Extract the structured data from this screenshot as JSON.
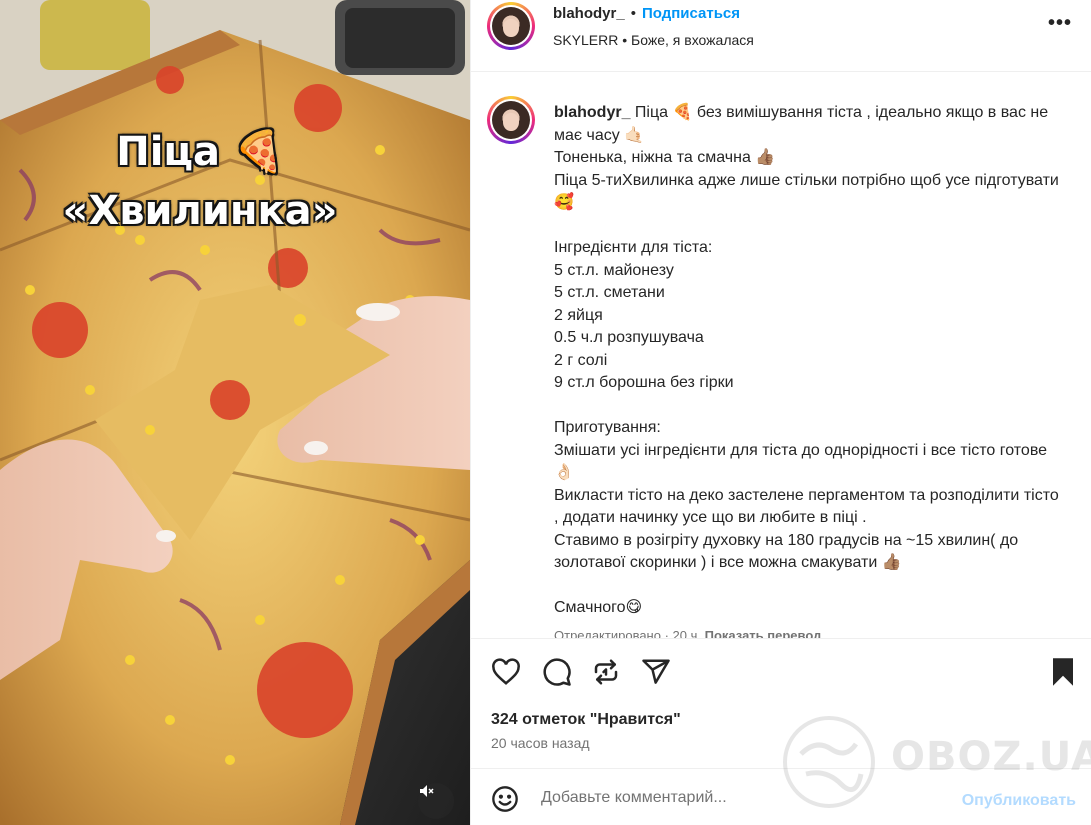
{
  "post": {
    "image_overlay_line1": "Піца 🍕",
    "image_overlay_line2": "«Хвилинка»"
  },
  "header": {
    "username": "blahodyr_",
    "separator": "•",
    "follow_label": "Подписаться",
    "audio_artist": "SKYLERR",
    "audio_separator": "•",
    "audio_title": "Боже, я вхожалася",
    "more_label": "•••"
  },
  "caption": {
    "username": "blahodyr_",
    "text": " Піца 🍕 без вимішування тіста , ідеально якщо в вас не має часу 🤙🏻\nТоненька, ніжна та смачна 👍🏽\nПіца 5-тиХвилинка адже лише стільки потрібно щоб усе підготувати 🥰\n\nІнгредієнти для тіста:\n5 ст.л. майонезу\n5 ст.л. сметани\n2 яйця\n0.5 ч.л розпушувача\n2 г солі\n9 ст.л борошна без гірки\n\nПриготування:\nЗмішати усі інгредієнти для тіста до однорідності і все тісто готове👌🏻\nВикласти тісто на деко застелене пергаментом та розподілити тісто , додати начинку усе що ви любите в піці .\nСтавимо в розігріту духовку на 180 градусів на ~15 хвилин( до золотавої скоринки ) і все можна смакувати 👍🏽\n\nСмачного😋",
    "edited_label": "Отредактировано · 20 ч.",
    "translate_label": "Показать перевод"
  },
  "actions": {
    "icons": [
      "heart-icon",
      "comment-icon",
      "repost-icon",
      "share-icon",
      "bookmark-icon"
    ],
    "likes_label": "324 отметок \"Нравится\"",
    "time_ago": "20 часов назад"
  },
  "comment": {
    "placeholder": "Добавьте комментарий...",
    "publish_label": "Опубликовать"
  },
  "watermark": {
    "text": "OBOZ.UA"
  },
  "colors": {
    "accent_blue": "#0095f6",
    "publish_disabled": "#b3dbff",
    "text_primary": "#262626",
    "text_secondary": "#737373",
    "border": "#efefef"
  }
}
